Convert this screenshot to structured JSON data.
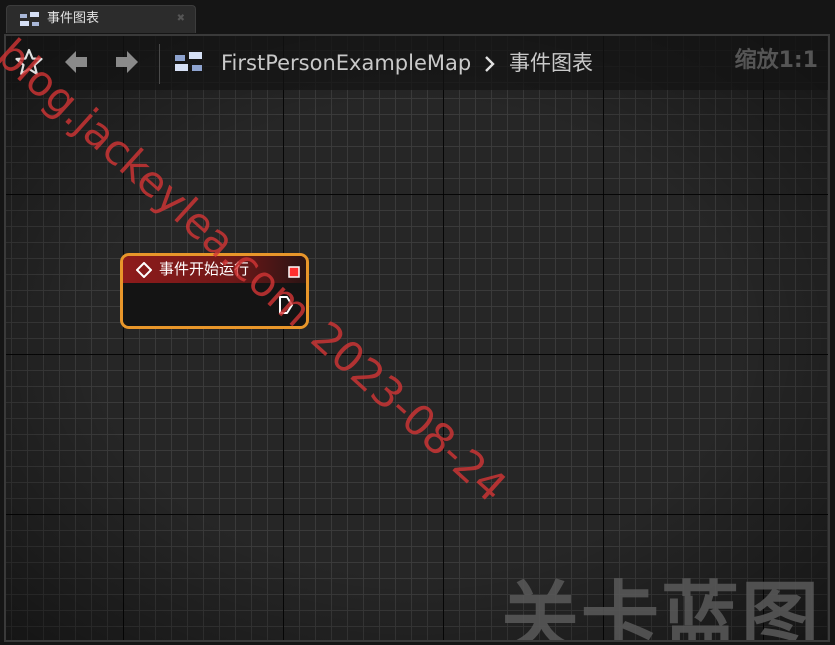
{
  "tab": {
    "label": "事件图表",
    "icon": "event-graph-icon",
    "close_icon": "close-icon"
  },
  "toolbar": {
    "favorite_icon": "star-icon",
    "back_icon": "back-arrow-icon",
    "forward_icon": "forward-arrow-icon",
    "breadcrumb_icon": "event-graph-icon",
    "breadcrumb_root": "FirstPersonExampleMap",
    "breadcrumb_separator_icon": "chevron-right-icon",
    "breadcrumb_current": "事件图表",
    "zoom": "缩放1:1"
  },
  "node": {
    "title": "事件开始运行",
    "header_icon": "event-diamond-icon",
    "delegate_icon": "delegate-pin-icon",
    "exec_output_icon": "exec-pin-icon",
    "header_color": "#8e1b1b",
    "border_color": "#e8962a"
  },
  "watermark": {
    "graph_type": "关卡蓝图",
    "site": "blog.jackeylea.com",
    "date": "2023-08-24",
    "site_color": "#d43535"
  },
  "colors": {
    "background": "#262626",
    "grid_major": "#000000",
    "grid_minor": "#3c3c3c"
  }
}
